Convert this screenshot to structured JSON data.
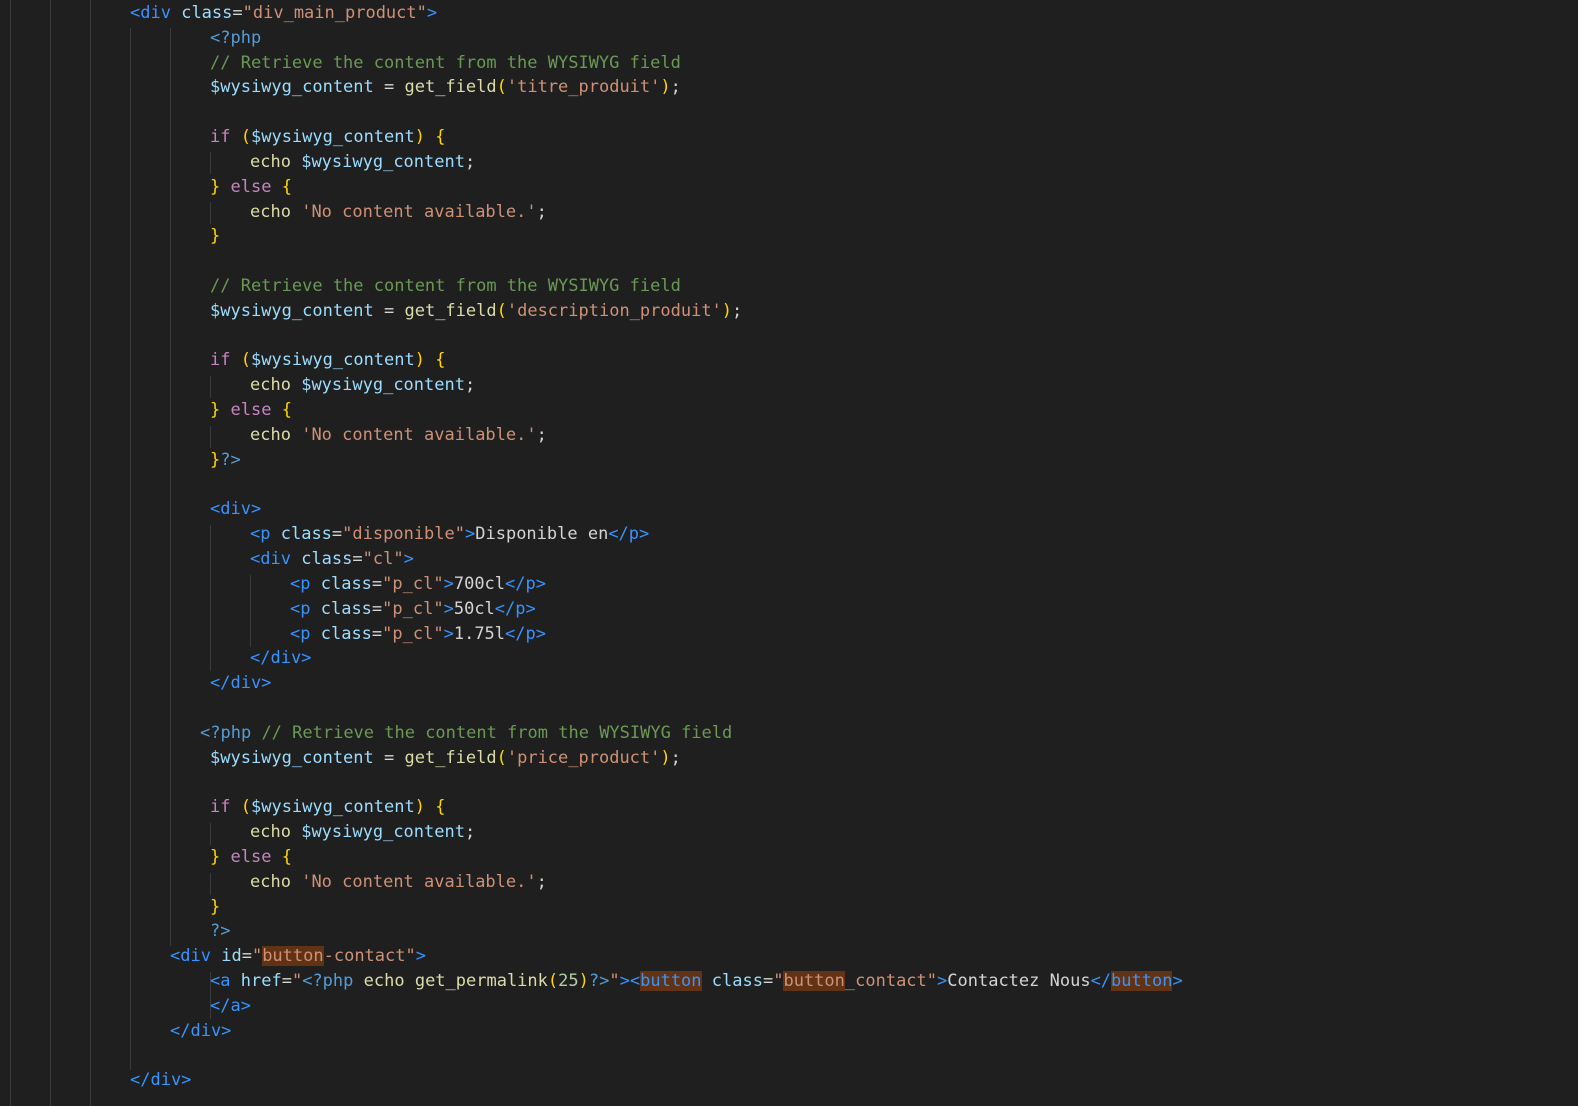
{
  "editor": {
    "language": "php",
    "lines": [
      [
        [
          "tag",
          "<div"
        ],
        [
          "plain",
          " "
        ],
        [
          "attr",
          "class"
        ],
        [
          "punc",
          "="
        ],
        [
          "str",
          "\"div_main_product\""
        ],
        [
          "tag",
          ">"
        ]
      ],
      [
        [
          "php",
          "<?php"
        ]
      ],
      [
        [
          "comment",
          "// Retrieve the content from the WYSIWYG field"
        ]
      ],
      [
        [
          "var",
          "$wysiwyg_content"
        ],
        [
          "plain",
          " = "
        ],
        [
          "fn",
          "get_field"
        ],
        [
          "brace",
          "("
        ],
        [
          "str",
          "'titre_produit'"
        ],
        [
          "brace",
          ")"
        ],
        [
          "punc",
          ";"
        ]
      ],
      [],
      [
        [
          "kw",
          "if"
        ],
        [
          "plain",
          " "
        ],
        [
          "brace",
          "("
        ],
        [
          "var",
          "$wysiwyg_content"
        ],
        [
          "brace",
          ")"
        ],
        [
          "plain",
          " "
        ],
        [
          "brace",
          "{"
        ]
      ],
      [
        [
          "fn",
          "echo"
        ],
        [
          "plain",
          " "
        ],
        [
          "var",
          "$wysiwyg_content"
        ],
        [
          "punc",
          ";"
        ]
      ],
      [
        [
          "brace",
          "}"
        ],
        [
          "plain",
          " "
        ],
        [
          "kw",
          "else"
        ],
        [
          "plain",
          " "
        ],
        [
          "brace",
          "{"
        ]
      ],
      [
        [
          "fn",
          "echo"
        ],
        [
          "plain",
          " "
        ],
        [
          "str",
          "'No content available.'"
        ],
        [
          "punc",
          ";"
        ]
      ],
      [
        [
          "brace",
          "}"
        ]
      ],
      [],
      [
        [
          "comment",
          "// Retrieve the content from the WYSIWYG field"
        ]
      ],
      [
        [
          "var",
          "$wysiwyg_content"
        ],
        [
          "plain",
          " = "
        ],
        [
          "fn",
          "get_field"
        ],
        [
          "brace",
          "("
        ],
        [
          "str",
          "'description_produit'"
        ],
        [
          "brace",
          ")"
        ],
        [
          "punc",
          ";"
        ]
      ],
      [],
      [
        [
          "kw",
          "if"
        ],
        [
          "plain",
          " "
        ],
        [
          "brace",
          "("
        ],
        [
          "var",
          "$wysiwyg_content"
        ],
        [
          "brace",
          ")"
        ],
        [
          "plain",
          " "
        ],
        [
          "brace",
          "{"
        ]
      ],
      [
        [
          "fn",
          "echo"
        ],
        [
          "plain",
          " "
        ],
        [
          "var",
          "$wysiwyg_content"
        ],
        [
          "punc",
          ";"
        ]
      ],
      [
        [
          "brace",
          "}"
        ],
        [
          "plain",
          " "
        ],
        [
          "kw",
          "else"
        ],
        [
          "plain",
          " "
        ],
        [
          "brace",
          "{"
        ]
      ],
      [
        [
          "fn",
          "echo"
        ],
        [
          "plain",
          " "
        ],
        [
          "str",
          "'No content available.'"
        ],
        [
          "punc",
          ";"
        ]
      ],
      [
        [
          "brace",
          "}"
        ],
        [
          "php",
          "?>"
        ]
      ],
      [],
      [
        [
          "tag",
          "<div>"
        ]
      ],
      [
        [
          "tag",
          "<p"
        ],
        [
          "plain",
          " "
        ],
        [
          "attr",
          "class"
        ],
        [
          "punc",
          "="
        ],
        [
          "str",
          "\"disponible\""
        ],
        [
          "tag",
          ">"
        ],
        [
          "plain",
          "Disponible en"
        ],
        [
          "tag",
          "</p>"
        ]
      ],
      [
        [
          "tag",
          "<div"
        ],
        [
          "plain",
          " "
        ],
        [
          "attr",
          "class"
        ],
        [
          "punc",
          "="
        ],
        [
          "str",
          "\"cl\""
        ],
        [
          "tag",
          ">"
        ]
      ],
      [
        [
          "tag",
          "<p"
        ],
        [
          "plain",
          " "
        ],
        [
          "attr",
          "class"
        ],
        [
          "punc",
          "="
        ],
        [
          "str",
          "\"p_cl\""
        ],
        [
          "tag",
          ">"
        ],
        [
          "plain",
          "700cl"
        ],
        [
          "tag",
          "</p>"
        ]
      ],
      [
        [
          "tag",
          "<p"
        ],
        [
          "plain",
          " "
        ],
        [
          "attr",
          "class"
        ],
        [
          "punc",
          "="
        ],
        [
          "str",
          "\"p_cl\""
        ],
        [
          "tag",
          ">"
        ],
        [
          "plain",
          "50cl"
        ],
        [
          "tag",
          "</p>"
        ]
      ],
      [
        [
          "tag",
          "<p"
        ],
        [
          "plain",
          " "
        ],
        [
          "attr",
          "class"
        ],
        [
          "punc",
          "="
        ],
        [
          "str",
          "\"p_cl\""
        ],
        [
          "tag",
          ">"
        ],
        [
          "plain",
          "1.75l"
        ],
        [
          "tag",
          "</p>"
        ]
      ],
      [
        [
          "tag",
          "</div>"
        ]
      ],
      [
        [
          "tag",
          "</div>"
        ]
      ],
      [],
      [
        [
          "php",
          "<?php"
        ],
        [
          "plain",
          " "
        ],
        [
          "comment",
          "// Retrieve the content from the WYSIWYG field"
        ]
      ],
      [
        [
          "var",
          "$wysiwyg_content"
        ],
        [
          "plain",
          " = "
        ],
        [
          "fn",
          "get_field"
        ],
        [
          "brace",
          "("
        ],
        [
          "str",
          "'price_product'"
        ],
        [
          "brace",
          ")"
        ],
        [
          "punc",
          ";"
        ]
      ],
      [],
      [
        [
          "kw",
          "if"
        ],
        [
          "plain",
          " "
        ],
        [
          "brace",
          "("
        ],
        [
          "var",
          "$wysiwyg_content"
        ],
        [
          "brace",
          ")"
        ],
        [
          "plain",
          " "
        ],
        [
          "brace",
          "{"
        ]
      ],
      [
        [
          "fn",
          "echo"
        ],
        [
          "plain",
          " "
        ],
        [
          "var",
          "$wysiwyg_content"
        ],
        [
          "punc",
          ";"
        ]
      ],
      [
        [
          "brace",
          "}"
        ],
        [
          "plain",
          " "
        ],
        [
          "kw",
          "else"
        ],
        [
          "plain",
          " "
        ],
        [
          "brace",
          "{"
        ]
      ],
      [
        [
          "fn",
          "echo"
        ],
        [
          "plain",
          " "
        ],
        [
          "str",
          "'No content available.'"
        ],
        [
          "punc",
          ";"
        ]
      ],
      [
        [
          "brace",
          "}"
        ]
      ],
      [
        [
          "php",
          "?>"
        ]
      ],
      [
        [
          "tag",
          "<div"
        ],
        [
          "plain",
          " "
        ],
        [
          "attr",
          "id"
        ],
        [
          "punc",
          "="
        ],
        [
          "str",
          "\""
        ],
        [
          "str hl",
          "button"
        ],
        [
          "str",
          "-contact\""
        ],
        [
          "tag",
          ">"
        ]
      ],
      [
        [
          "tag",
          "<a"
        ],
        [
          "plain",
          " "
        ],
        [
          "attr",
          "href"
        ],
        [
          "punc",
          "="
        ],
        [
          "str",
          "\""
        ],
        [
          "php",
          "<?php"
        ],
        [
          "plain",
          " "
        ],
        [
          "fn",
          "echo"
        ],
        [
          "plain",
          " "
        ],
        [
          "fn",
          "get_permalink"
        ],
        [
          "brace",
          "("
        ],
        [
          "num",
          "25"
        ],
        [
          "brace",
          ")"
        ],
        [
          "php",
          "?>"
        ],
        [
          "str",
          "\""
        ],
        [
          "tag",
          ">"
        ],
        [
          "tag",
          "<"
        ],
        [
          "tag hl",
          "button"
        ],
        [
          "plain",
          " "
        ],
        [
          "attr",
          "class"
        ],
        [
          "punc",
          "="
        ],
        [
          "str",
          "\""
        ],
        [
          "str hl",
          "button"
        ],
        [
          "str",
          "_contact\""
        ],
        [
          "tag",
          ">"
        ],
        [
          "plain",
          "Contactez Nous"
        ],
        [
          "tag",
          "</"
        ],
        [
          "tag hl",
          "button"
        ],
        [
          "tag",
          ">"
        ]
      ],
      [
        [
          "tag",
          "</a>"
        ]
      ],
      [
        [
          "tag",
          "</div>"
        ]
      ],
      [],
      [
        [
          "tag",
          "</div>"
        ]
      ]
    ]
  }
}
